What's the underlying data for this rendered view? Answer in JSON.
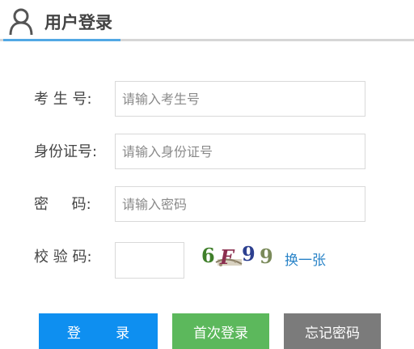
{
  "header": {
    "title": "用户登录",
    "icon": "user-icon",
    "accent_color": "#52a8e4"
  },
  "form": {
    "exam_number": {
      "label": "考 生 号:",
      "placeholder": "请输入考生号",
      "value": ""
    },
    "id_number": {
      "label": "身份证号:",
      "placeholder": "请输入身份证号",
      "value": ""
    },
    "password": {
      "label": "密     码:",
      "placeholder": "请输入密码",
      "value": ""
    },
    "captcha": {
      "label": "校 验 码:",
      "value": "",
      "image_text": "6F99",
      "refresh_label": "换一张"
    }
  },
  "buttons": {
    "login": "登        录",
    "first_login": "首次登录",
    "forgot_password": "忘记密码"
  },
  "colors": {
    "login_button": "#0e8ff0",
    "first_login_button": "#5cb85c",
    "forgot_button": "#7b7b7b",
    "link": "#2a84c8"
  }
}
